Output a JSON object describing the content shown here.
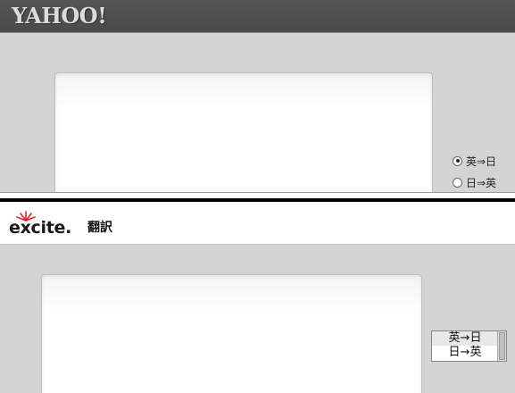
{
  "yahoo": {
    "logo_text": "YAHOO!",
    "direction_options": [
      {
        "label": "英⇒日",
        "selected": true
      },
      {
        "label": "日⇒英",
        "selected": false
      }
    ]
  },
  "excite": {
    "logo_text": "excite.",
    "title": "翻訳",
    "direction_options": [
      {
        "label": "英→日",
        "selected": true
      },
      {
        "label": "日→英",
        "selected": false
      }
    ]
  }
}
